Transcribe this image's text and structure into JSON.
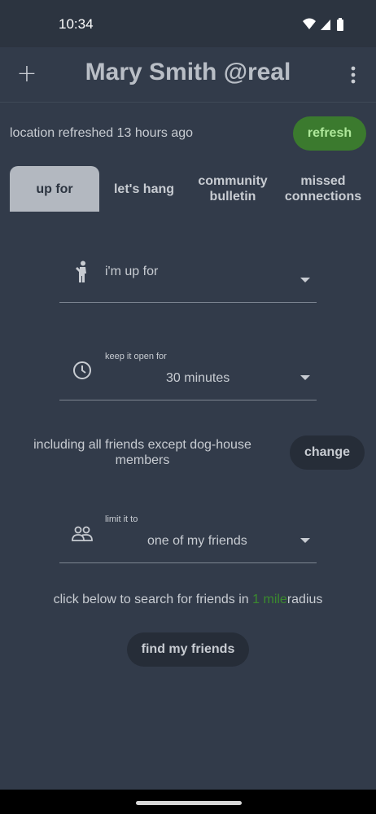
{
  "status_bar": {
    "time": "10:34",
    "icons": [
      "wifi-icon",
      "signal-icon",
      "battery-icon"
    ]
  },
  "app_bar": {
    "title": "Mary Smith @real",
    "add_icon": "plus-icon",
    "menu_icon": "more-vert-icon"
  },
  "location": {
    "text": "location refreshed 13 hours ago",
    "refresh_label": "refresh"
  },
  "tabs": [
    {
      "label": "up for",
      "active": true
    },
    {
      "label": "let's hang",
      "active": false
    },
    {
      "label": "community bulletin",
      "active": false
    },
    {
      "label": "missed connections",
      "active": false
    }
  ],
  "form": {
    "up_for": {
      "icon": "person-icon",
      "placeholder": "i'm up for"
    },
    "open_for": {
      "icon": "clock-icon",
      "label": "keep it open for",
      "value": "30 minutes"
    },
    "including": {
      "text": "including all friends except dog-house members",
      "change_label": "change"
    },
    "limit": {
      "icon": "people-icon",
      "label": "limit it to",
      "value": "one of my friends"
    }
  },
  "search": {
    "prefix": "click below to search for friends in",
    "radius": "1 mile",
    "suffix": "radius",
    "button_label": "find my friends"
  },
  "colors": {
    "background": "#323b4a",
    "accent_green": "#3b7a2e",
    "active_tab": "#b3b8c0"
  }
}
